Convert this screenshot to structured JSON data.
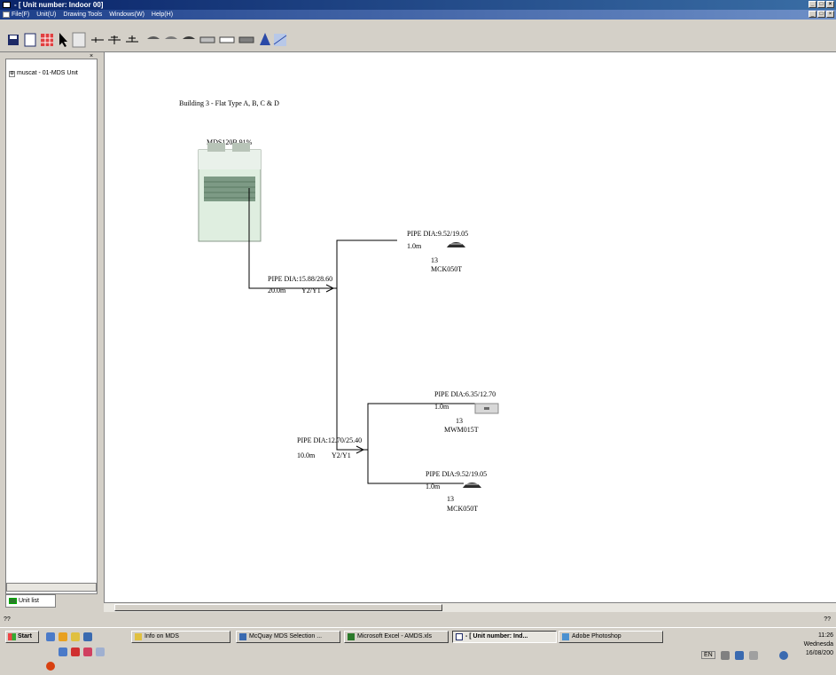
{
  "window": {
    "title": "- [ Unit number: Indoor 00]",
    "minimize": "_",
    "restore": "□",
    "close": "×"
  },
  "menu": {
    "items": [
      "File(F)",
      "Unit(U)",
      "Drawing Tools",
      "Windows(W)",
      "Help(H)"
    ]
  },
  "left_panel": {
    "tree_item": "muscat - 01-MDS Unit",
    "expander": "⊕",
    "close_glyph": "×",
    "tab_label": "Unit list"
  },
  "diagram": {
    "heading": "Building 3 - Flat Type A, B, C & D",
    "outdoor_unit": "MDS120B 91%",
    "pipes": [
      {
        "dia": "PIPE DIA:15.88/28.60",
        "length": "20.0m",
        "joint": "Y2/Y1"
      },
      {
        "dia": "PIPE DIA:12.70/25.40",
        "length": "10.0m",
        "joint": "Y2/Y1"
      }
    ],
    "branches": [
      {
        "dia": "PIPE DIA:9.52/19.05",
        "length": "1.0m",
        "number": "13",
        "model": "MCK050T"
      },
      {
        "dia": "PIPE DIA:6.35/12.70",
        "length": "1.0m",
        "number": "13",
        "model": "MWM015T"
      },
      {
        "dia": "PIPE DIA:9.52/19.05",
        "length": "1.0m",
        "number": "13",
        "model": "MCK050T"
      }
    ]
  },
  "status": {
    "text": "??",
    "right": "??"
  },
  "taskbar": {
    "start": "Start",
    "tasks": [
      {
        "label": "Info on MDS",
        "active": false
      },
      {
        "label": "McQuay MDS Selection ...",
        "active": false
      },
      {
        "label": "Microsoft Excel - AMDS.xls",
        "active": false
      },
      {
        "label": "- [ Unit number: Ind...",
        "active": true
      },
      {
        "label": "Adobe Photoshop",
        "active": false
      }
    ],
    "lang": "EN",
    "time": "11:26",
    "day": "Wednesda",
    "date": "16/08/200"
  }
}
